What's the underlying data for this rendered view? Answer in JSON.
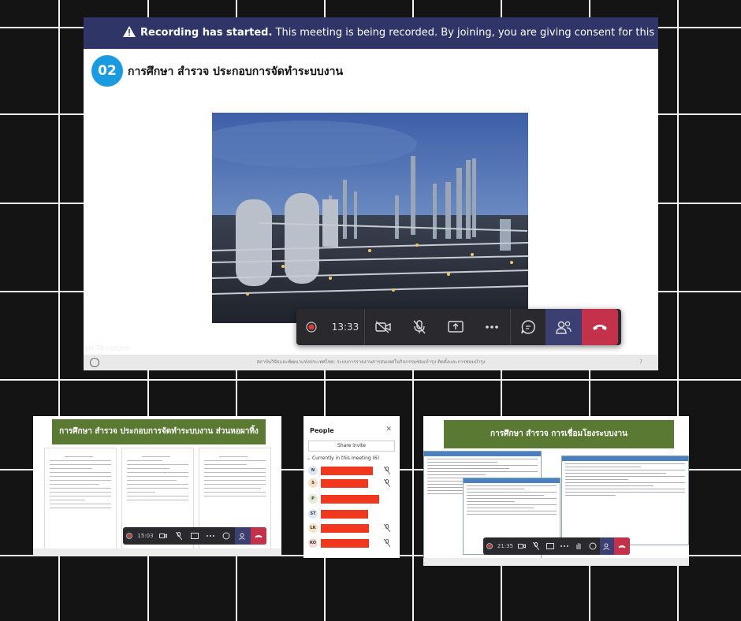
{
  "main": {
    "banner": {
      "bold": "Recording has started.",
      "text": " This meeting is being recorded. By joining, you are giving consent for this meeting to be record"
    },
    "slide": {
      "number": "02",
      "title": "การศึกษา สำรวจ ประกอบการจัดทำระบบงาน"
    },
    "participant_name": "an Tavarom",
    "footer_text": "สถาบันวิจัยและพัฒนาแห่งประเทศไทย: ระบบการรายงานสารสนเทศในกิจกรรมซ่อมบำรุง ติดตั้งและการซ่อมบำรุง",
    "page_number": "7",
    "controls": {
      "timer": "13:33",
      "icons": [
        "record-icon",
        "camera-off-icon",
        "mic-off-icon",
        "share-screen-icon",
        "more-icon",
        "chat-icon",
        "people-icon",
        "hang-up-icon"
      ]
    }
  },
  "thumb_left": {
    "title": "การศึกษา สำรวจ ประกอบการจัดทำระบบงาน ส่วนหอผาทิ้ง",
    "timer": "15:03"
  },
  "people_panel": {
    "title": "People",
    "close": "✕",
    "share_invite": "Share invite",
    "section": "Currently in this meeting (6)",
    "participants": [
      {
        "initials": "N",
        "color": "#dfe4f5"
      },
      {
        "initials": "S",
        "color": "#f7e0c8"
      },
      {
        "initials": "P",
        "color": "#e1ecd5"
      },
      {
        "initials": "ST",
        "color": "#dde7f4"
      },
      {
        "initials": "LK",
        "color": "#f6e2c4"
      },
      {
        "initials": "KO",
        "color": "#f5dcdc"
      }
    ]
  },
  "thumb_right": {
    "title": "การศึกษา สำรวจ การเชื่อมโยงระบบงาน",
    "timer": "21:35"
  },
  "colors": {
    "banner": "#2f3566",
    "accent": "#1a9be0",
    "slide_green": "#5a7a34",
    "hang_up": "#c4314b",
    "redaction": "#f2371f"
  }
}
